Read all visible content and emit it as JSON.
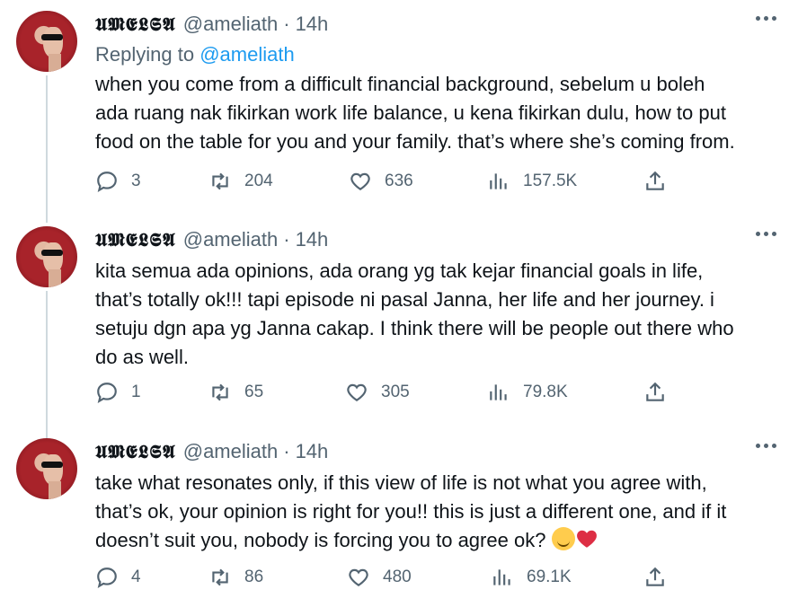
{
  "tweets": [
    {
      "display_name": "𝖀𝕸𝕰𝕷𝕾𝕬",
      "handle": "@ameliath",
      "time": "14h",
      "replying_prefix": "Replying to",
      "replying_handle": "@ameliath",
      "text": "when you come from a difficult financial background, sebelum u boleh\nada ruang nak fikirkan work life balance, u kena fikirkan dulu, how to put\nfood on the table for you and your family. that’s where she’s coming from.",
      "replies": "3",
      "retweets": "204",
      "likes": "636",
      "views": "157.5K"
    },
    {
      "display_name": "𝖀𝕸𝕰𝕷𝕾𝕬",
      "handle": "@ameliath",
      "time": "14h",
      "text": "kita semua ada opinions, ada orang yg tak kejar financial goals in life,\nthat’s totally ok!!! tapi episode ni pasal Janna, her life and her journey. i\nsetuju dgn apa yg Janna cakap. I think there will be people out there who\ndo as well.",
      "replies": "1",
      "retweets": "65",
      "likes": "305",
      "views": "79.8K"
    },
    {
      "display_name": "𝖀𝕸𝕰𝕷𝕾𝕬",
      "handle": "@ameliath",
      "time": "14h",
      "text": "take what resonates only, if this view of life is not what you agree with,\nthat’s ok, your opinion is right for you!! this is just a different one, and if it\ndoesn’t suit you, nobody is forcing you to agree ok?",
      "replies": "4",
      "retweets": "86",
      "likes": "480",
      "views": "69.1K"
    }
  ],
  "colors": {
    "accent": "#1d9bf0",
    "muted": "#536471",
    "text": "#0f1419",
    "thread_line": "#cfd9de"
  },
  "icons": [
    "reply-icon",
    "retweet-icon",
    "like-icon",
    "views-icon",
    "share-icon",
    "more-icon"
  ]
}
